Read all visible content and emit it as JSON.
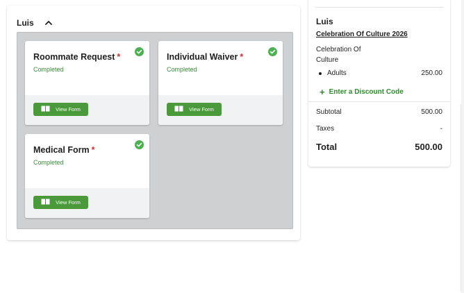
{
  "person": {
    "name": "Luis"
  },
  "forms": [
    {
      "title": "Roommate Request",
      "required_mark": "*",
      "status": "Completed",
      "button_label": "View Form"
    },
    {
      "title": "Individual Waiver",
      "required_mark": "*",
      "status": "Completed",
      "button_label": "View Form"
    },
    {
      "title": "Medical Form",
      "required_mark": "*",
      "status": "Completed",
      "button_label": "View Form"
    }
  ],
  "summary": {
    "name": "Luis",
    "event_link": "Celebration Of Culture 2026",
    "event_name": "Celebration Of Culture",
    "line_items": [
      {
        "label": "Adults",
        "amount": "250.00"
      }
    ],
    "discount_label": "Enter a Discount Code",
    "subtotal_label": "Subtotal",
    "subtotal_value": "500.00",
    "taxes_label": "Taxes",
    "taxes_value": "-",
    "total_label": "Total",
    "total_value": "500.00"
  },
  "colors": {
    "accent_green": "#4a9a3c",
    "status_green": "#3a8d3a",
    "required_red": "#d32f2f",
    "check_green": "#4caf50"
  },
  "icons": [
    "chevron-up-icon",
    "check-circle-icon",
    "book-icon",
    "plus-icon"
  ]
}
